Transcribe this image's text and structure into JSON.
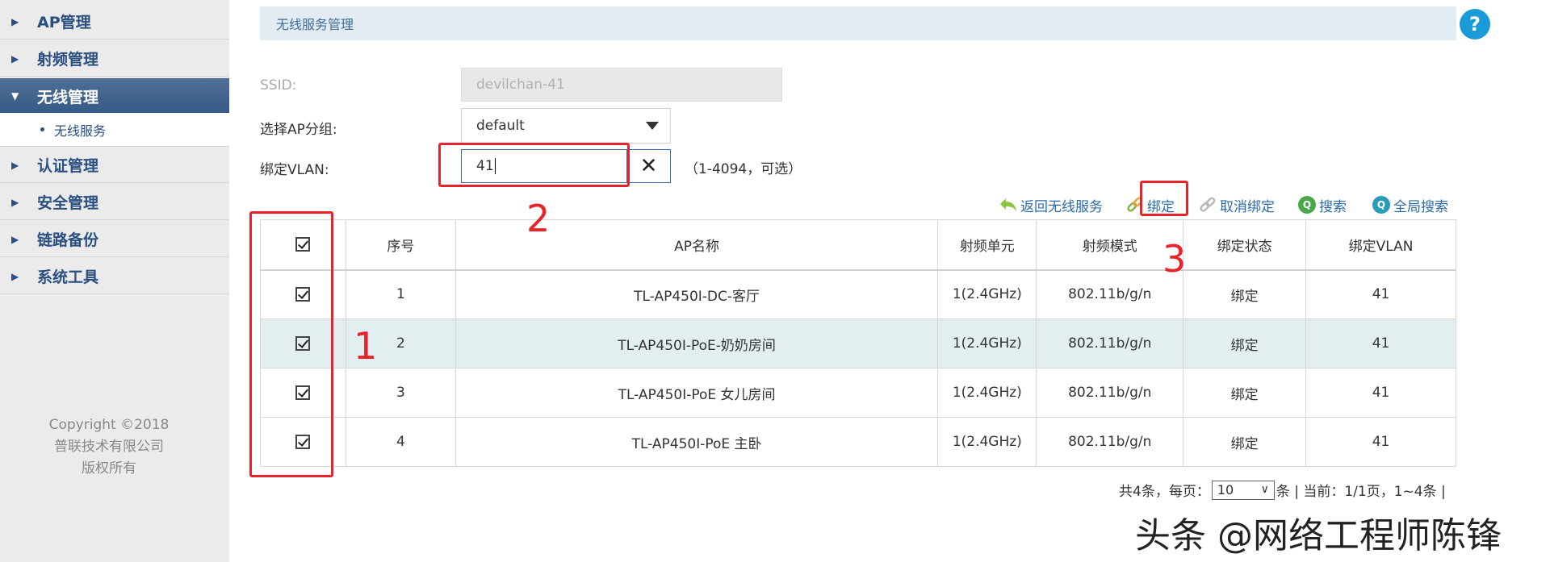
{
  "sidebar": {
    "items": [
      {
        "label": "AP管理"
      },
      {
        "label": "射频管理"
      },
      {
        "label": "无线管理"
      },
      {
        "label": "认证管理"
      },
      {
        "label": "安全管理"
      },
      {
        "label": "链路备份"
      },
      {
        "label": "系统工具"
      }
    ],
    "sub_item": "无线服务",
    "copyright": [
      "Copyright ©2018",
      "普联技术有限公司",
      "版权所有"
    ]
  },
  "header": {
    "title": "无线服务管理",
    "help": "?"
  },
  "form": {
    "ssid_label": "SSID:",
    "ssid_value": "devilchan-41",
    "group_label": "选择AP分组:",
    "group_value": "default",
    "vlan_label": "绑定VLAN:",
    "vlan_value": "41",
    "vlan_hint": "（1-4094，可选）"
  },
  "toolbar": {
    "back": "返回无线服务",
    "bind": "绑定",
    "unbind": "取消绑定",
    "search": "搜索",
    "global_search": "全局搜索"
  },
  "table": {
    "columns": [
      "序号",
      "AP名称",
      "射频单元",
      "射频模式",
      "绑定状态",
      "绑定VLAN"
    ],
    "rows": [
      [
        "1",
        "TL-AP450I-DC-客厅",
        "1(2.4GHz)",
        "802.11b/g/n",
        "绑定",
        "41"
      ],
      [
        "2",
        "TL-AP450I-PoE-奶奶房间",
        "1(2.4GHz)",
        "802.11b/g/n",
        "绑定",
        "41"
      ],
      [
        "3",
        "TL-AP450I-PoE 女儿房间",
        "1(2.4GHz)",
        "802.11b/g/n",
        "绑定",
        "41"
      ],
      [
        "4",
        "TL-AP450I-PoE 主卧",
        "1(2.4GHz)",
        "802.11b/g/n",
        "绑定",
        "41"
      ]
    ]
  },
  "pager": {
    "prefix": "共4条，每页：",
    "per_page": "10",
    "suffix": "条 | 当前：1/1页，1~4条 |"
  },
  "annotations": {
    "n1": "1",
    "n2": "2",
    "n3": "3"
  },
  "watermark": "头条 @网络工程师陈锋",
  "colors": {
    "accent": "#2a4f80",
    "annotation": "#e8242a",
    "highlight_row": "#e3eef0"
  }
}
